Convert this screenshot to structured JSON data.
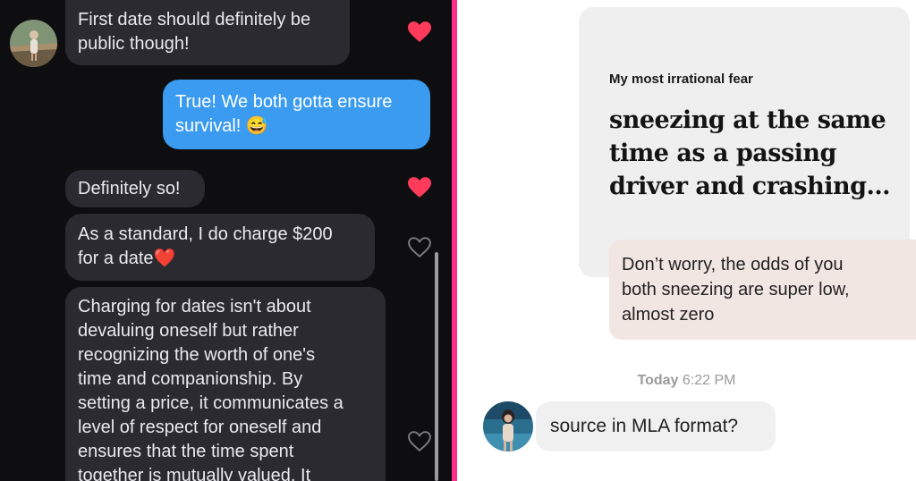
{
  "left_chat": {
    "messages": [
      {
        "from": "them",
        "lines": [
          "First date should definitely be",
          "public though!"
        ],
        "liked": true
      },
      {
        "from": "me",
        "lines": [
          "True! We both gotta ensure",
          "survival! 😅"
        ]
      },
      {
        "from": "them",
        "lines": [
          "Definitely so!"
        ],
        "liked": true
      },
      {
        "from": "them",
        "lines": [
          "As a standard, I do charge $200",
          "for a date❤️"
        ],
        "liked": false
      },
      {
        "from": "them",
        "lines": [
          "Charging for dates isn't about",
          "devaluing oneself but rather",
          "recognizing the worth of one's",
          "time and companionship. By",
          "setting a price, it communicates a",
          "level of respect for oneself and",
          "ensures that the time spent",
          "together is mutually valued. It"
        ],
        "liked": false
      }
    ],
    "colors": {
      "background": "#0e0e10",
      "their_bubble": "#2a2a30",
      "my_bubble": "#3a9bf0",
      "heart_liked": "#ff3b5c"
    }
  },
  "right_chat": {
    "prompt": {
      "label": "My most irrational fear",
      "answer_lines": [
        "sneezing at the same",
        "time as a passing",
        "driver and crashing…"
      ]
    },
    "reply": {
      "lines": [
        "Don’t worry, the odds of you",
        "both sneezing are super low,",
        "almost zero"
      ]
    },
    "timestamp": {
      "day": "Today",
      "time": "6:22 PM"
    },
    "message": "source in MLA format?"
  },
  "divider_color": "#ff2d8a"
}
